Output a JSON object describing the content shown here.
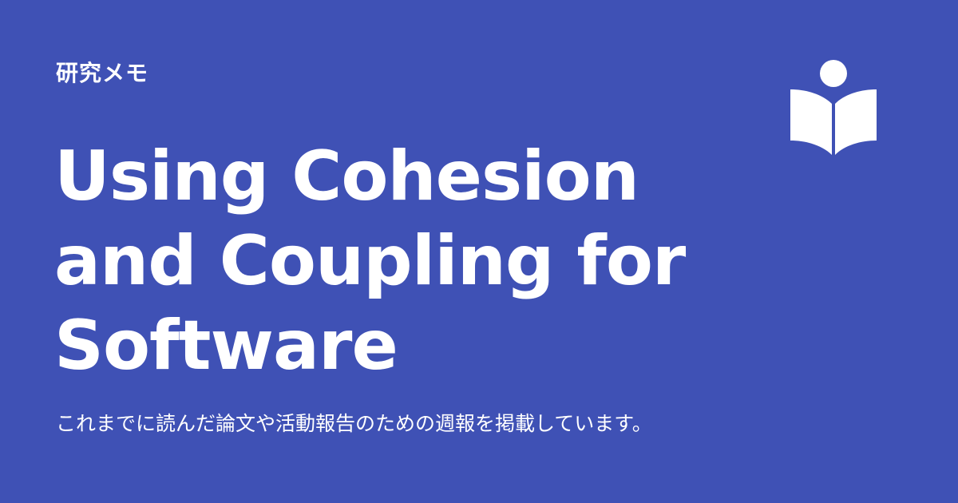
{
  "card": {
    "category": "研究メモ",
    "title": "Using Cohesion and Coupling for Software",
    "description": "これまでに読んだ論文や活動報告のための週報を掲載しています。",
    "background_color": "#3f51b5",
    "text_color": "#ffffff",
    "logo_icon": "book-reader-icon"
  }
}
